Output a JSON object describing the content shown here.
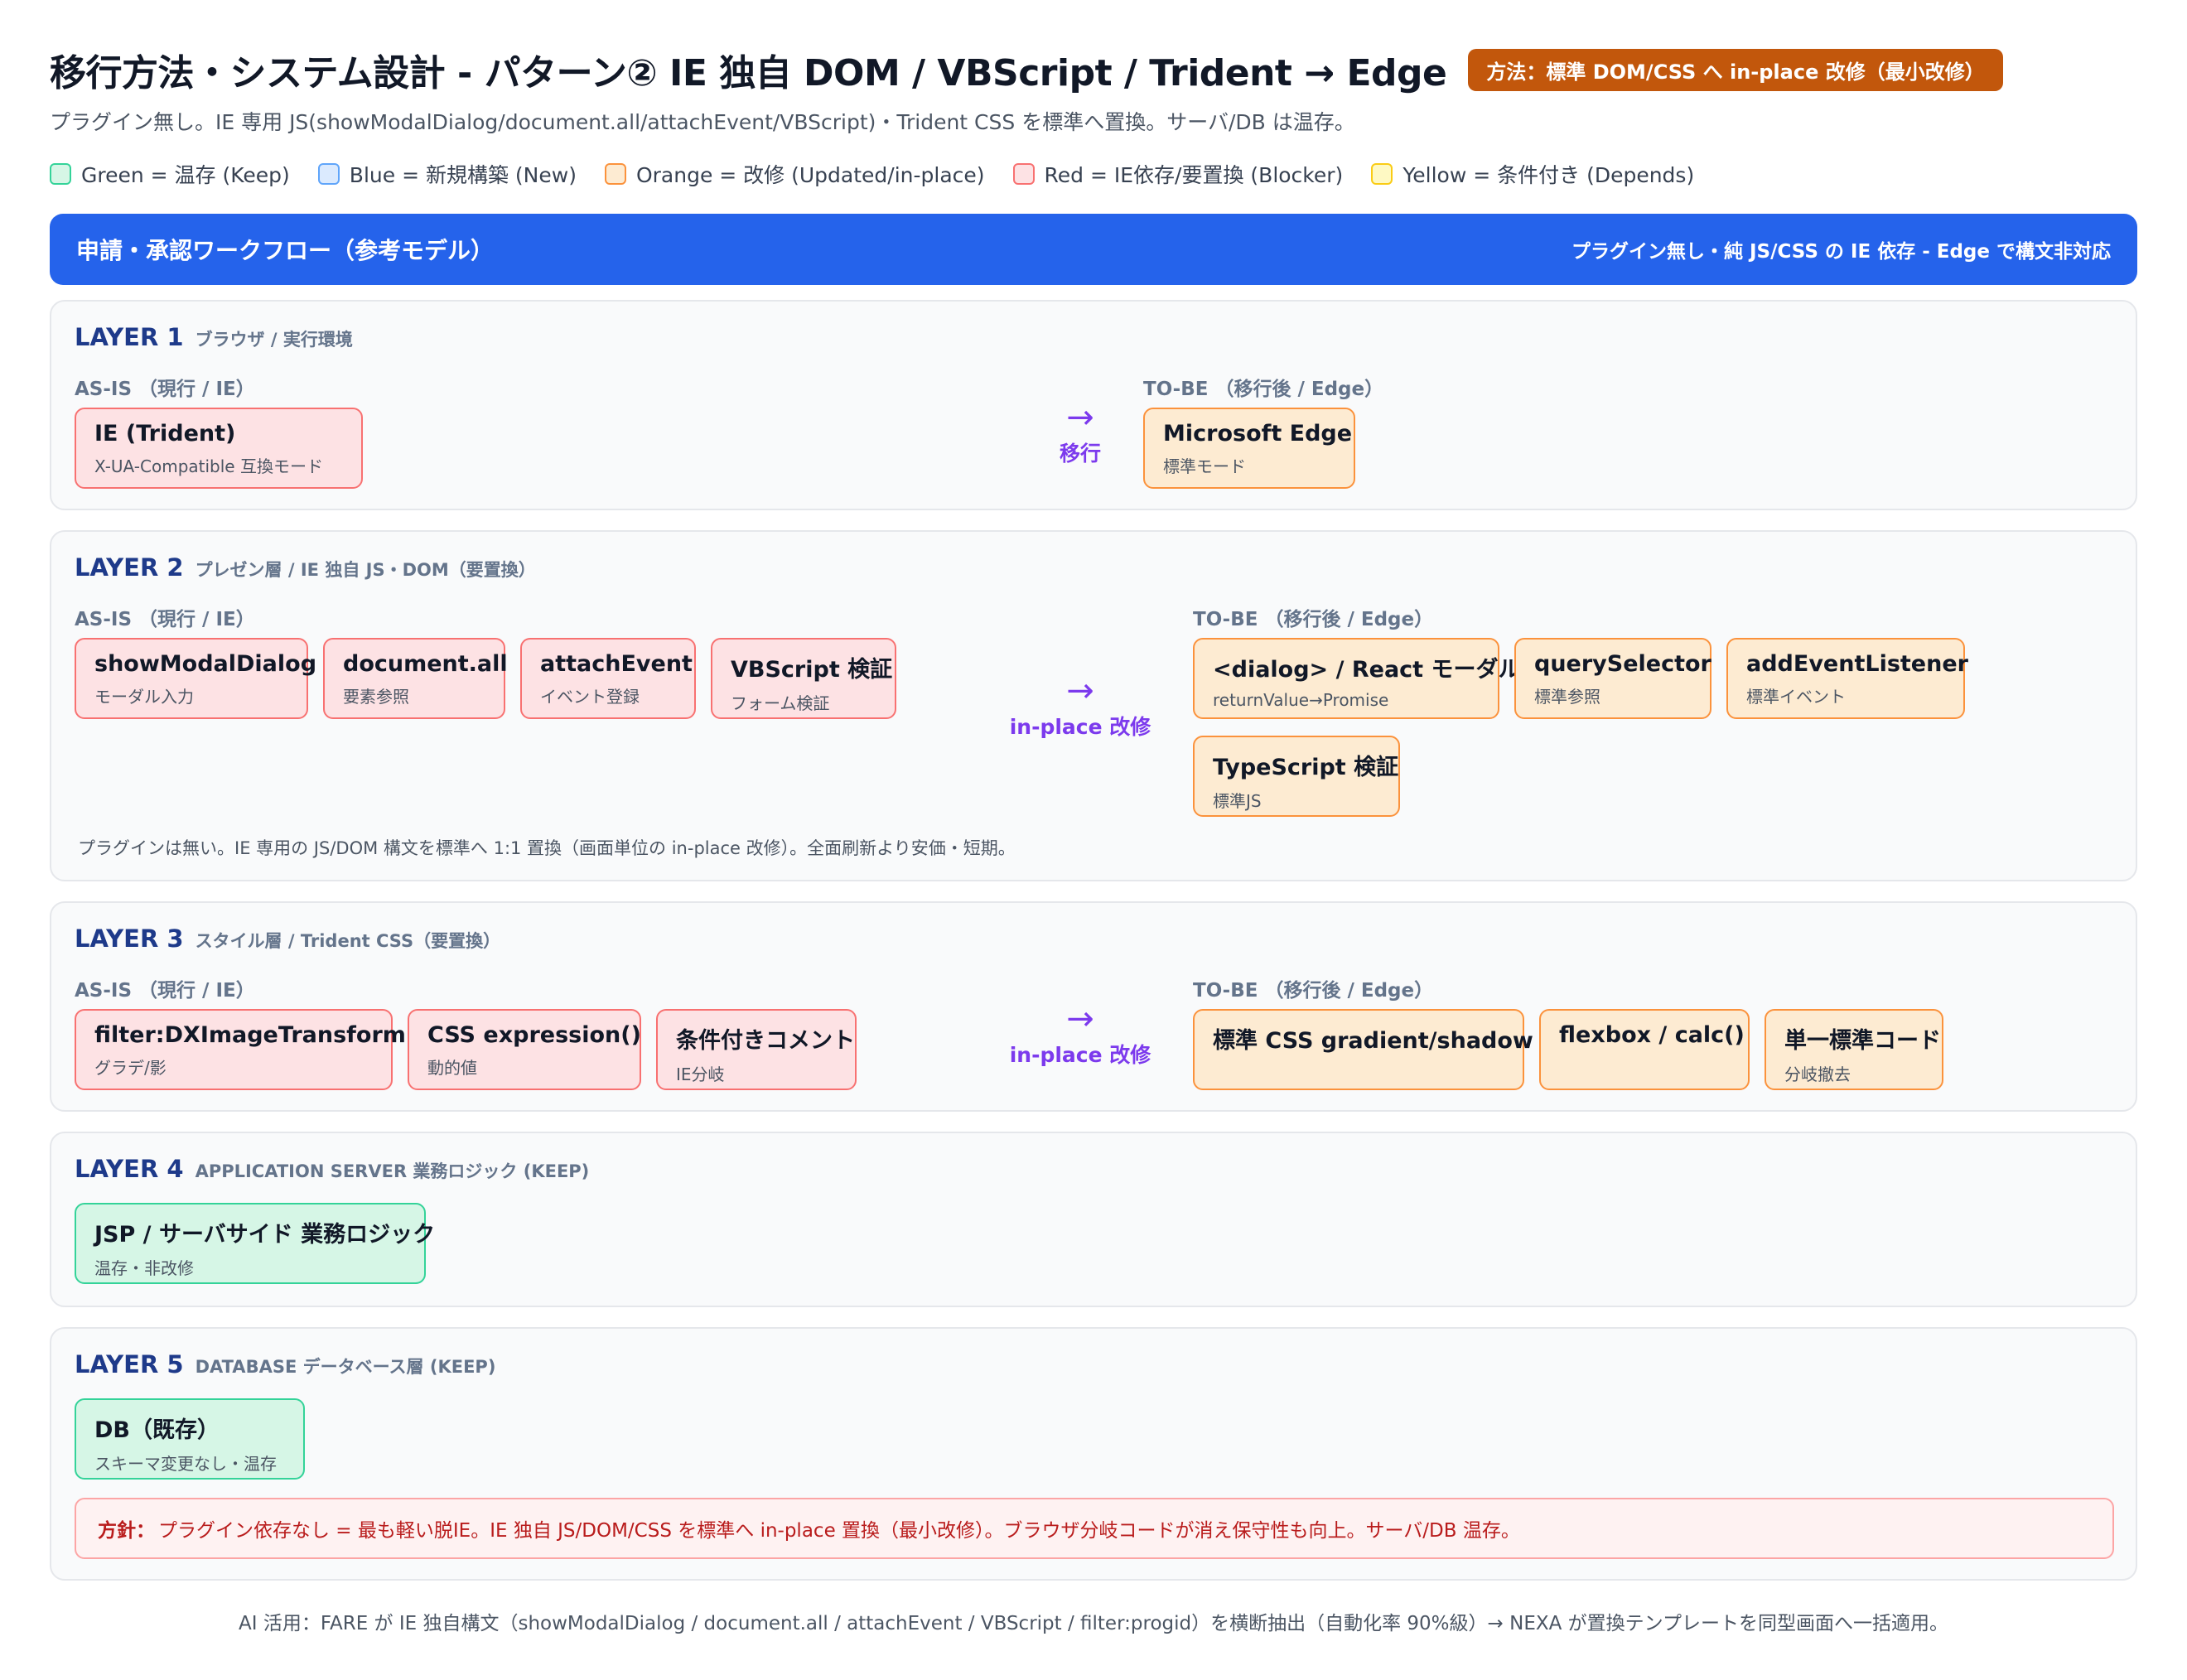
{
  "header": {
    "title": "移行方法・システム設計 - パターン② IE 独自 DOM / VBScript / Trident → Edge",
    "method_badge": "方法：標準 DOM/CSS へ in-place 改修（最小改修）",
    "subtitle": "プラグイン無し。IE 専用 JS(showModalDialog/document.all/attachEvent/VBScript)・Trident CSS を標準へ置換。サーバ/DB は温存。"
  },
  "legend": [
    {
      "label": "Green = 温存 (Keep)",
      "fill": "#d6f6e6",
      "border": "#34d399"
    },
    {
      "label": "Blue = 新規構築 (New)",
      "fill": "#dbeafe",
      "border": "#60a5fa"
    },
    {
      "label": "Orange = 改修 (Updated/in-place)",
      "fill": "#fdebd2",
      "border": "#fb923c"
    },
    {
      "label": "Red = IE依存/要置換 (Blocker)",
      "fill": "#fde2e4",
      "border": "#f87171"
    },
    {
      "label": "Yellow = 条件付き (Depends)",
      "fill": "#fef9c3",
      "border": "#facc15"
    }
  ],
  "workflow": {
    "title": "申請・承認ワークフロー（参考モデル）",
    "note": "プラグイン無し・純 JS/CSS の IE 依存 - Edge で構文非対応"
  },
  "labels": {
    "as_is": "AS-IS （現行 / IE）",
    "to_be": "TO-BE （移行後 / Edge）"
  },
  "layers": {
    "l1": {
      "num": "LAYER 1",
      "desc": "ブラウザ / 実行環境",
      "arrow": "移行",
      "as_is": [
        {
          "title": "IE (Trident)",
          "sub": "X-UA-Compatible 互換モード"
        }
      ],
      "to_be": [
        {
          "title": "Microsoft Edge",
          "sub": "標準モード"
        }
      ]
    },
    "l2": {
      "num": "LAYER 2",
      "desc": "プレゼン層 / IE 独自 JS・DOM（要置換）",
      "arrow": "in-place 改修",
      "as_is": [
        {
          "title": "showModalDialog",
          "sub": "モーダル入力"
        },
        {
          "title": "document.all",
          "sub": "要素参照"
        },
        {
          "title": "attachEvent",
          "sub": "イベント登録"
        },
        {
          "title": "VBScript 検証",
          "sub": "フォーム検証"
        }
      ],
      "to_be": [
        {
          "title": "<dialog> / React モーダル",
          "sub": "returnValue→Promise"
        },
        {
          "title": "querySelector",
          "sub": "標準参照"
        },
        {
          "title": "addEventListener",
          "sub": "標準イベント"
        },
        {
          "title": "TypeScript 検証",
          "sub": "標準JS"
        }
      ],
      "note": "プラグインは無い。IE 専用の JS/DOM 構文を標準へ 1:1 置換（画面単位の in-place 改修）。全面刷新より安価・短期。"
    },
    "l3": {
      "num": "LAYER 3",
      "desc": "スタイル層 / Trident CSS（要置換）",
      "arrow": "in-place 改修",
      "as_is": [
        {
          "title": "filter:DXImageTransform",
          "sub": "グラデ/影"
        },
        {
          "title": "CSS expression()",
          "sub": "動的値"
        },
        {
          "title": "条件付きコメント",
          "sub": "IE分岐"
        }
      ],
      "to_be": [
        {
          "title": "標準 CSS gradient/shadow",
          "sub": ""
        },
        {
          "title": "flexbox / calc()",
          "sub": ""
        },
        {
          "title": "単一標準コード",
          "sub": "分岐撤去"
        }
      ]
    },
    "l4": {
      "num": "LAYER 4",
      "desc": "APPLICATION SERVER 業務ロジック (KEEP)",
      "items": [
        {
          "title": "JSP / サーバサイド 業務ロジック",
          "sub": "温存・非改修"
        }
      ]
    },
    "l5": {
      "num": "LAYER 5",
      "desc": "DATABASE データベース層 (KEEP)",
      "items": [
        {
          "title": "DB（既存）",
          "sub": "スキーマ変更なし・温存"
        }
      ],
      "policy_label": "方針：",
      "policy_text": "プラグイン依存なし = 最も軽い脱IE。IE 独自 JS/DOM/CSS を標準へ in-place 置換（最小改修）。ブラウザ分岐コードが消え保守性も向上。サーバ/DB 温存。"
    }
  },
  "footer": "AI 活用：FARE が IE 独自構文（showModalDialog / document.all / attachEvent / VBScript / filter:progid）を横断抽出（自動化率 90%級）→ NEXA が置換テンプレートを同型画面へ一括適用。"
}
